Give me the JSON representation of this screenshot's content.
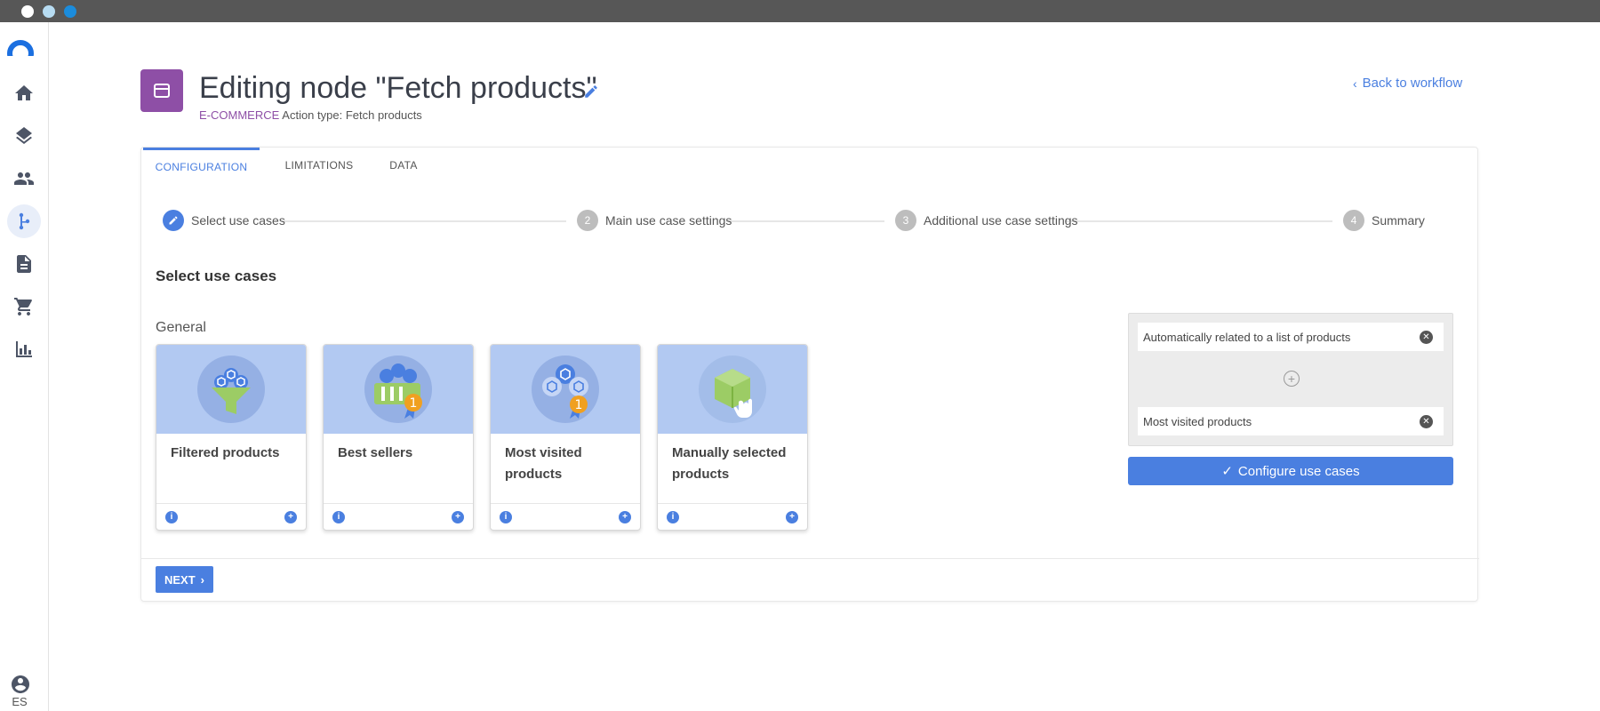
{
  "header": {
    "title": "Editing node \"Fetch products\"",
    "category": "E-COMMERCE",
    "action_type": "Action type: Fetch products",
    "back_link": "Back to workflow"
  },
  "sidebar": {
    "items": [
      {
        "name": "home",
        "icon": "home-icon"
      },
      {
        "name": "layers",
        "icon": "layers-icon"
      },
      {
        "name": "users",
        "icon": "people-icon"
      },
      {
        "name": "workflows",
        "icon": "workflow-icon",
        "active": true
      },
      {
        "name": "documents",
        "icon": "document-icon"
      },
      {
        "name": "shop",
        "icon": "cart-icon"
      },
      {
        "name": "analytics",
        "icon": "bar-chart-icon"
      }
    ],
    "language": "ES"
  },
  "tabs": [
    {
      "label": "CONFIGURATION",
      "active": true
    },
    {
      "label": "LIMITATIONS"
    },
    {
      "label": "DATA"
    }
  ],
  "stepper": [
    {
      "number": "",
      "label": "Select use cases",
      "active": true
    },
    {
      "number": "2",
      "label": "Main use case settings"
    },
    {
      "number": "3",
      "label": "Additional use case settings"
    },
    {
      "number": "4",
      "label": "Summary"
    }
  ],
  "section_title": "Select use cases",
  "group_label": "General",
  "use_cases": [
    {
      "label": "Filtered products"
    },
    {
      "label": "Best sellers",
      "badge": "1"
    },
    {
      "label": "Most visited products",
      "badge": "1"
    },
    {
      "label": "Manually selected products"
    }
  ],
  "selected": [
    {
      "label": "Automatically related to a list of products"
    },
    {
      "label": "Most visited products"
    }
  ],
  "configure_button": "Configure use cases",
  "next_button": "NEXT",
  "colors": {
    "accent": "#4a7fe0",
    "category": "#8e4fa6"
  }
}
